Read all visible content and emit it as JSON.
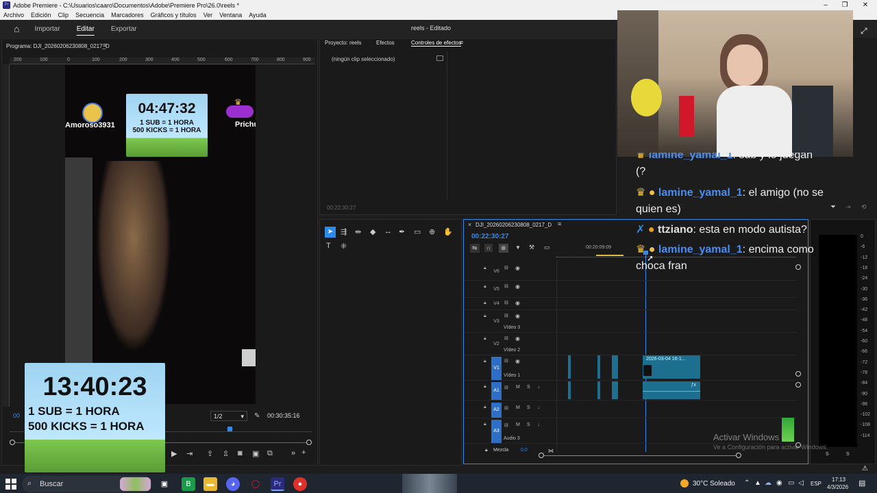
{
  "window": {
    "title": "Adobe Premiere - C:\\Usuarios\\caaro\\Documentos\\Adobe\\Premiere Pro\\26.0\\reels *",
    "app_icon": "Pr",
    "controls": [
      "–",
      "❐",
      "✕"
    ]
  },
  "menu": [
    "Archivo",
    "Edición",
    "Clip",
    "Secuencia",
    "Marcadores",
    "Gráficos y títulos",
    "Ver",
    "Ventana",
    "Ayuda"
  ],
  "header": {
    "home_icon": "⌂",
    "tabs": [
      "Importar",
      "Editar",
      "Exportar"
    ],
    "active_tab": "Editar",
    "project_title": "reels - Editado"
  },
  "program_monitor": {
    "title": "Programa: DJI_20260206230808_0217_D",
    "ruler_labels": [
      "200",
      "100",
      "0",
      "100",
      "200",
      "300",
      "400",
      "500",
      "600",
      "700",
      "800",
      "900"
    ],
    "timecode_left": "00",
    "resolution": "1/2",
    "duration": "00:30:35:16"
  },
  "overlay_top": {
    "timer": "04:47:32",
    "line1": "1 SUB = 1 HORA",
    "line2": "500 KICKS = 1 HORA",
    "user_left": "Amoroso3931",
    "user_right": "Prichu"
  },
  "overlay_bottom": {
    "timer": "13:40:23",
    "line1": "1 SUB = 1 HORA",
    "line2": "500 KICKS = 1 HORA"
  },
  "effects_panel": {
    "tabs": [
      "Proyecto: reels",
      "Efectos",
      "Controles de efectos"
    ],
    "active_tab": "Controles de efectos",
    "empty_text": "(ningún clip seleccionado)",
    "timecode": "00:22:30:27"
  },
  "timeline": {
    "sequence_name": "DJI_20260206230808_0217_D",
    "timecode": "00:22:30:27",
    "ruler_mark": "00:20:09:09",
    "tracks": [
      {
        "id": "V6",
        "label": ""
      },
      {
        "id": "V5",
        "label": ""
      },
      {
        "id": "V4",
        "label": ""
      },
      {
        "id": "V3",
        "label": "Vídeo 3"
      },
      {
        "id": "V2",
        "label": "Vídeo 2"
      },
      {
        "id": "V1",
        "label": "Vídeo 1"
      },
      {
        "id": "A1",
        "label": ""
      },
      {
        "id": "A2",
        "label": ""
      },
      {
        "id": "A3",
        "label": "Audio 3"
      }
    ],
    "clip_name": "2026-03-04 16-1...",
    "mix_label": "Mezcla",
    "mix_value": "0,0"
  },
  "audio_meter": {
    "ticks": [
      "0",
      "-6",
      "-12",
      "-18",
      "-24",
      "-30",
      "-36",
      "-42",
      "-48",
      "-54",
      "-60",
      "-66",
      "-72",
      "-78",
      "-84",
      "-90",
      "-96",
      "-102",
      "-108",
      "-114"
    ],
    "bottom": [
      "S",
      "S"
    ]
  },
  "chat": [
    {
      "user": "lamine_yamal_1",
      "text": ": sub y lo juegan",
      "cont": "(?"
    },
    {
      "user": "lamine_yamal_1",
      "text": ": el amigo (no se",
      "cont": "quien es)"
    },
    {
      "user": "ttziano",
      "text": ": esta en modo autista?"
    },
    {
      "user": "lamine_yamal_1",
      "text": ": encima como",
      "cont": "choca fran"
    }
  ],
  "watermark": {
    "title": "Activar Windows",
    "subtitle": "Ve a Configuración para activar Windows."
  },
  "taskbar": {
    "search_placeholder": "Buscar",
    "weather": "30°C  Soleado",
    "lang": "ESP",
    "time": "17:13",
    "date": "4/3/2026"
  },
  "colors": {
    "accent_blue": "#2d8ceb",
    "clip_teal": "#1d6f8f",
    "chat_user": "#4a8df0"
  }
}
